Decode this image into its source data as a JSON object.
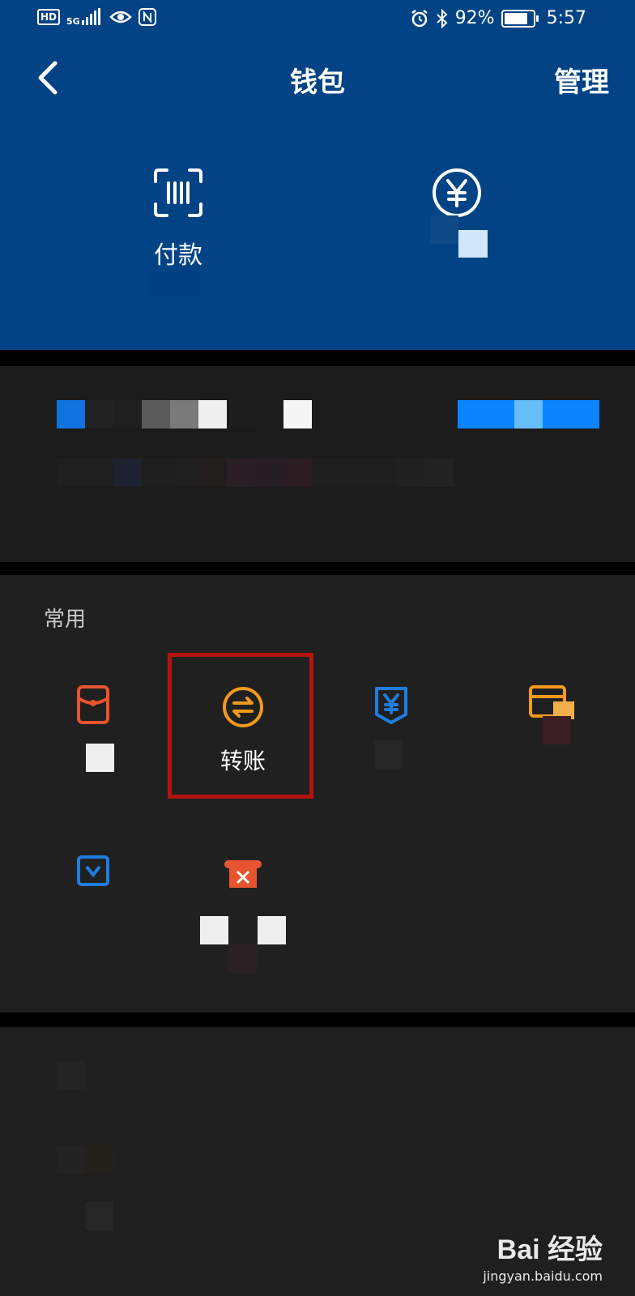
{
  "status_bar": {
    "hd": "HD",
    "network": "5G",
    "battery_percent": "92%",
    "battery_level": 0.92,
    "time": "5:57",
    "icons": [
      "hd-icon",
      "signal-icon",
      "eye-icon",
      "nfc-icon",
      "alarm-icon",
      "bluetooth-icon",
      "battery-icon"
    ]
  },
  "nav": {
    "back_icon": "chevron-left-icon",
    "title": "钱包",
    "manage": "管理"
  },
  "actions": {
    "pay": {
      "label": "付款",
      "icon": "barcode-scan-icon"
    },
    "coin": {
      "icon": "yuan-circle-icon"
    }
  },
  "common": {
    "title": "常用",
    "items": [
      {
        "icon": "red-envelope-icon",
        "color": "#e8542e"
      },
      {
        "label": "转账",
        "icon": "transfer-icon",
        "color": "#f39a1c"
      },
      {
        "icon": "yuan-shield-icon",
        "color": "#1f7de0"
      },
      {
        "icon": "card-icon",
        "color": "#f39a1c"
      },
      {
        "icon": "blue-card-icon",
        "color": "#1f7de0"
      },
      {
        "icon": "orange-box-icon",
        "color": "#e8542e"
      }
    ]
  },
  "colors": {
    "header_bg": "#014384",
    "highlight": "#b3140e",
    "mosaic_blue": "#0a84ff"
  },
  "watermark": {
    "logo": "Bai 经验",
    "url": "jingyan.baidu.com"
  }
}
